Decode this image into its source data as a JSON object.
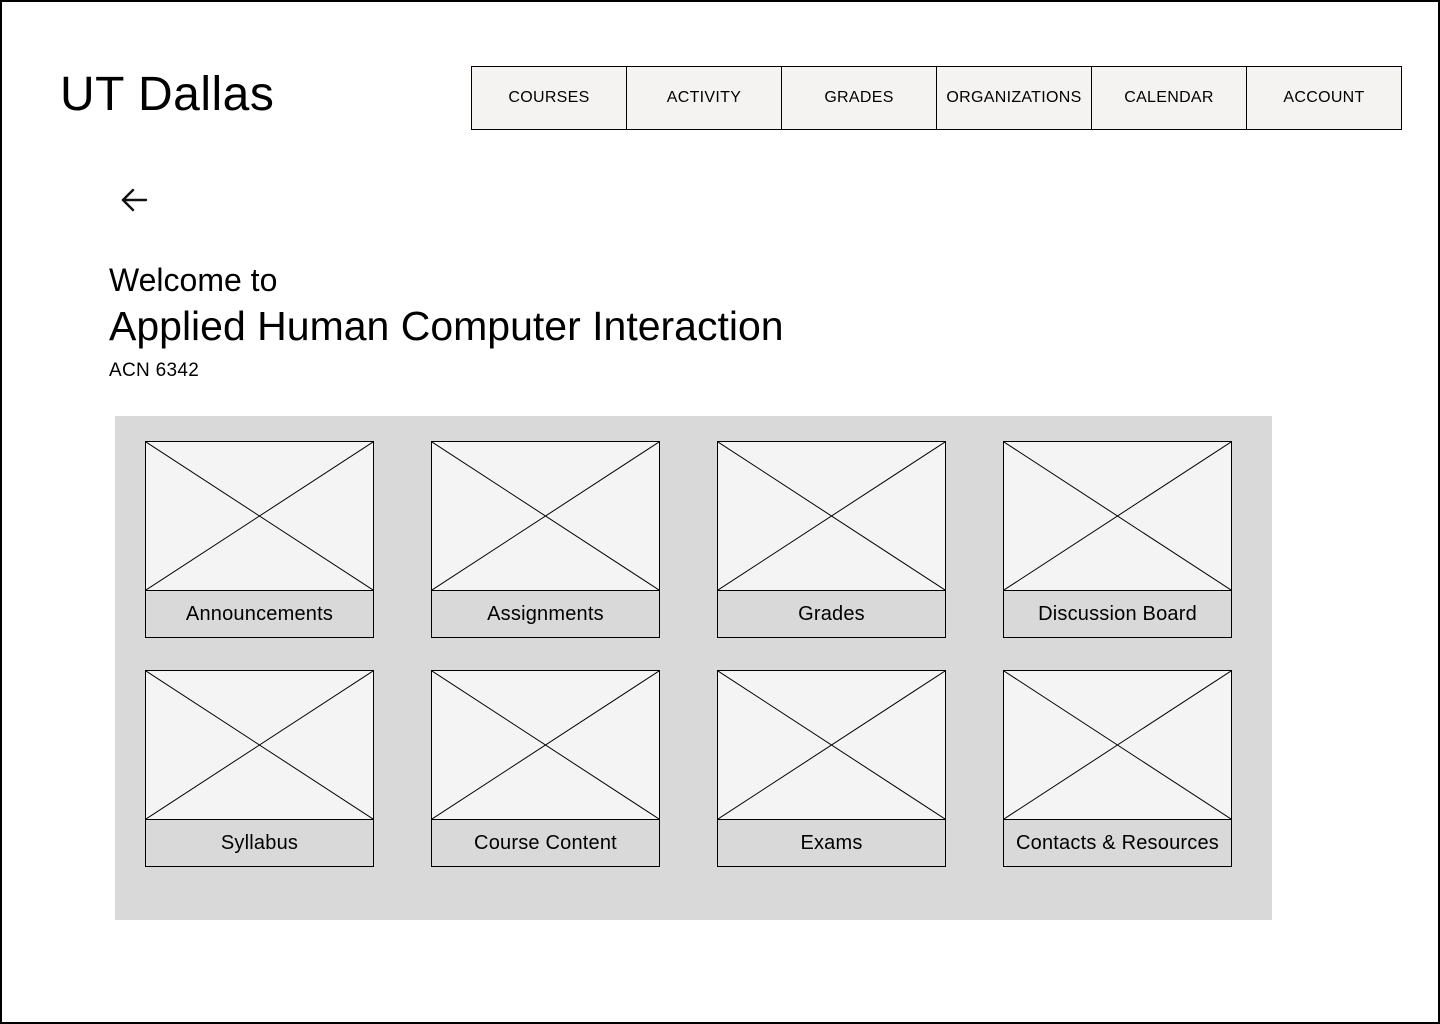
{
  "brand": {
    "name": "UT Dallas"
  },
  "nav": {
    "items": [
      {
        "label": "COURSES"
      },
      {
        "label": "ACTIVITY"
      },
      {
        "label": "GRADES"
      },
      {
        "label": "ORGANIZATIONS"
      },
      {
        "label": "CALENDAR"
      },
      {
        "label": "ACCOUNT"
      }
    ]
  },
  "back": {
    "icon": "arrow-left-icon"
  },
  "course": {
    "welcome": "Welcome to",
    "title": "Applied Human Computer Interaction",
    "code": "ACN 6342"
  },
  "tiles": [
    {
      "label": "Announcements",
      "icon": "image-placeholder-icon"
    },
    {
      "label": "Assignments",
      "icon": "image-placeholder-icon"
    },
    {
      "label": "Grades",
      "icon": "image-placeholder-icon"
    },
    {
      "label": "Discussion Board",
      "icon": "image-placeholder-icon"
    },
    {
      "label": "Syllabus",
      "icon": "image-placeholder-icon"
    },
    {
      "label": "Course Content",
      "icon": "image-placeholder-icon"
    },
    {
      "label": "Exams",
      "icon": "image-placeholder-icon"
    },
    {
      "label": "Contacts & Resources",
      "icon": "image-placeholder-icon"
    }
  ],
  "colors": {
    "nav_background": "#f5f3f2",
    "panel_background": "#d9d9d9",
    "placeholder_background": "#f4f4f4",
    "border": "#000000"
  }
}
